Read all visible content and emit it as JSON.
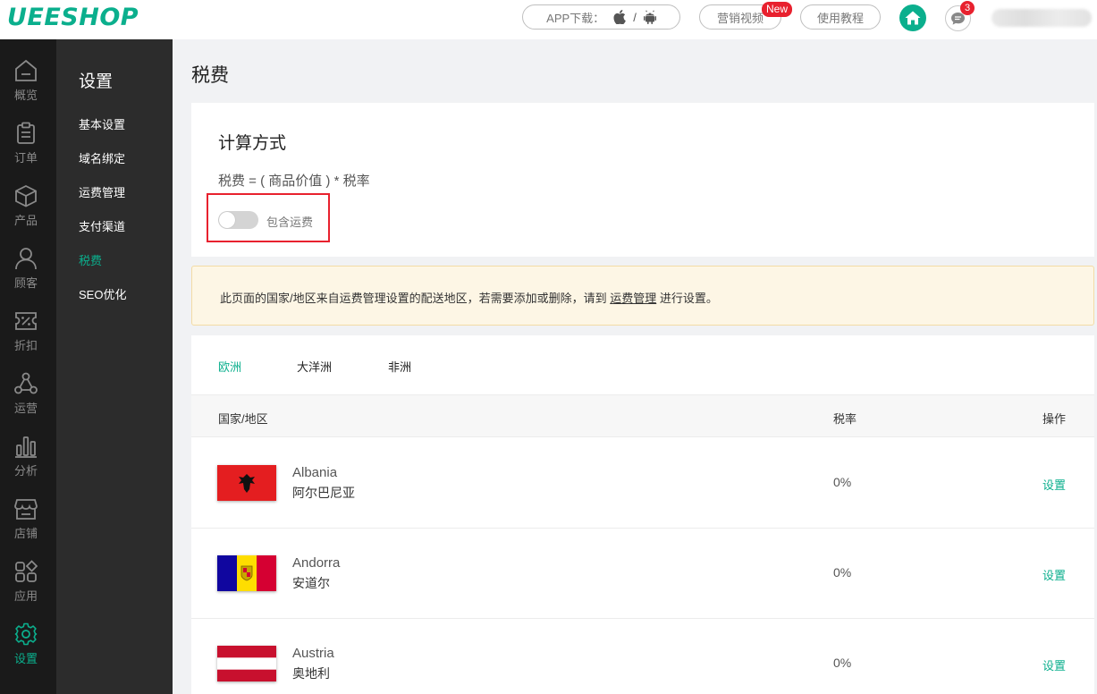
{
  "header": {
    "logo": "UEESHOP",
    "app_download": "APP下载：",
    "app_sep": "/",
    "marketing_video": "营销视频",
    "new_badge": "New",
    "tutorial": "使用教程",
    "message_count": "3",
    "accent_color": "#0baf8d",
    "badge_color": "#e8212e"
  },
  "rail": {
    "items": [
      {
        "label": "概览",
        "icon": "home-outline-icon"
      },
      {
        "label": "订单",
        "icon": "clipboard-icon"
      },
      {
        "label": "产品",
        "icon": "box-icon"
      },
      {
        "label": "顾客",
        "icon": "user-icon"
      },
      {
        "label": "折扣",
        "icon": "discount-icon"
      },
      {
        "label": "运营",
        "icon": "network-icon"
      },
      {
        "label": "分析",
        "icon": "bar-chart-icon"
      },
      {
        "label": "店铺",
        "icon": "store-icon"
      },
      {
        "label": "应用",
        "icon": "apps-icon"
      },
      {
        "label": "设置",
        "icon": "gear-icon",
        "active": true
      }
    ]
  },
  "submenu": {
    "title": "设置",
    "items": [
      {
        "label": "基本设置"
      },
      {
        "label": "域名绑定"
      },
      {
        "label": "运费管理"
      },
      {
        "label": "支付渠道"
      },
      {
        "label": "税费",
        "active": true
      },
      {
        "label": "SEO优化"
      }
    ]
  },
  "page": {
    "title": "税费"
  },
  "calc": {
    "heading": "计算方式",
    "formula": "税费 = ( 商品价值 ) * 税率",
    "toggle_label": "包含运费",
    "toggle_on": false
  },
  "notice": {
    "text_before": "此页面的国家/地区来自运费管理设置的配送地区，若需要添加或删除，请到 ",
    "link": "运费管理",
    "text_after": " 进行设置。"
  },
  "tabs": [
    {
      "label": "欧洲",
      "active": true
    },
    {
      "label": "大洋洲"
    },
    {
      "label": "非洲"
    }
  ],
  "table": {
    "columns": [
      "国家/地区",
      "税率",
      "操作"
    ],
    "rows": [
      {
        "name": "Albania",
        "name_cn": "阿尔巴尼亚",
        "rate": "0%",
        "action": "设置",
        "flag": "albania-flag"
      },
      {
        "name": "Andorra",
        "name_cn": "安道尔",
        "rate": "0%",
        "action": "设置",
        "flag": "andorra-flag"
      },
      {
        "name": "Austria",
        "name_cn": "奥地利",
        "rate": "0%",
        "action": "设置",
        "flag": "austria-flag"
      }
    ]
  }
}
